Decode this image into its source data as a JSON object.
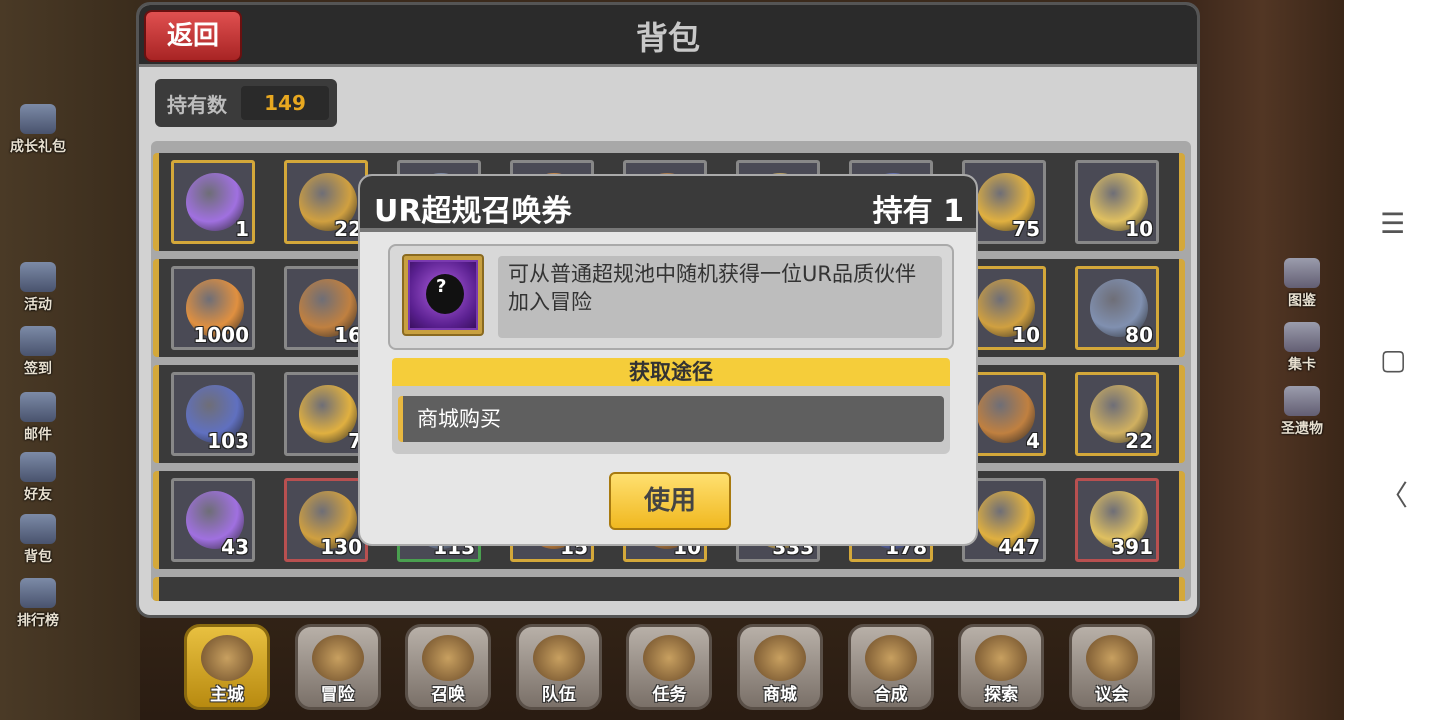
{
  "panel": {
    "title": "背包",
    "back_label": "返回",
    "count_label": "持有数",
    "count_value": "149"
  },
  "left_menu": [
    {
      "label": "成长礼包",
      "icon": "gift-bag-icon"
    },
    {
      "label": "活动",
      "icon": "activity-icon"
    },
    {
      "label": "签到",
      "icon": "checkin-icon"
    },
    {
      "label": "邮件",
      "icon": "mail-icon"
    },
    {
      "label": "好友",
      "icon": "friends-icon"
    },
    {
      "label": "背包",
      "icon": "backpack-icon"
    },
    {
      "label": "排行榜",
      "icon": "ranking-icon"
    }
  ],
  "right_menu": [
    {
      "label": "图鉴",
      "icon": "codex-icon"
    },
    {
      "label": "集卡",
      "icon": "card-collect-icon"
    },
    {
      "label": "圣遗物",
      "icon": "relic-icon"
    }
  ],
  "grid": {
    "rows": [
      {
        "items": [
          {
            "qty": "1",
            "border": "gold"
          },
          {
            "qty": "22",
            "border": "gold"
          },
          {
            "qty": "",
            "border": "plain"
          },
          {
            "qty": "",
            "border": "plain"
          },
          {
            "qty": "",
            "border": "plain"
          },
          {
            "qty": "",
            "border": "plain"
          },
          {
            "qty": "",
            "border": "plain"
          },
          {
            "qty": "75",
            "border": "plain"
          },
          {
            "qty": "10",
            "border": "plain"
          }
        ]
      },
      {
        "items": [
          {
            "qty": "1000",
            "border": "plain"
          },
          {
            "qty": "16",
            "border": "plain"
          },
          {
            "qty": "",
            "border": "plain"
          },
          {
            "qty": "",
            "border": "plain"
          },
          {
            "qty": "",
            "border": "plain"
          },
          {
            "qty": "",
            "border": "plain"
          },
          {
            "qty": "",
            "border": "plain"
          },
          {
            "qty": "10",
            "border": "gold"
          },
          {
            "qty": "80",
            "border": "gold"
          }
        ]
      },
      {
        "items": [
          {
            "qty": "103",
            "border": "plain"
          },
          {
            "qty": "7",
            "border": "plain"
          },
          {
            "qty": "",
            "border": "plain"
          },
          {
            "qty": "",
            "border": "plain"
          },
          {
            "qty": "",
            "border": "plain"
          },
          {
            "qty": "",
            "border": "plain"
          },
          {
            "qty": "",
            "border": "plain"
          },
          {
            "qty": "4",
            "border": "gold"
          },
          {
            "qty": "22",
            "border": "gold"
          }
        ]
      },
      {
        "items": [
          {
            "qty": "43",
            "border": "plain"
          },
          {
            "qty": "130",
            "border": "red"
          },
          {
            "qty": "113",
            "border": "green"
          },
          {
            "qty": "15",
            "border": "gold"
          },
          {
            "qty": "10",
            "border": "gold"
          },
          {
            "qty": "333",
            "border": "plain"
          },
          {
            "qty": "178",
            "border": "gold"
          },
          {
            "qty": "447",
            "border": "plain"
          },
          {
            "qty": "391",
            "border": "red"
          }
        ]
      }
    ]
  },
  "bottom_nav": [
    {
      "label": "主城",
      "icon": "castle-icon",
      "active": true
    },
    {
      "label": "冒险",
      "icon": "adventure-icon",
      "active": false
    },
    {
      "label": "召唤",
      "icon": "summon-icon",
      "active": false
    },
    {
      "label": "队伍",
      "icon": "team-icon",
      "active": false
    },
    {
      "label": "任务",
      "icon": "quest-icon",
      "active": false
    },
    {
      "label": "商城",
      "icon": "shop-icon",
      "active": false
    },
    {
      "label": "合成",
      "icon": "craft-icon",
      "active": false
    },
    {
      "label": "探索",
      "icon": "explore-icon",
      "active": false
    },
    {
      "label": "议会",
      "icon": "council-icon",
      "active": false
    }
  ],
  "dialog": {
    "title": "UR超规召唤券",
    "owned": "持有 1",
    "description": "可从普通超规池中随机获得一位UR品质伙伴加入冒险",
    "source_header": "获取途径",
    "source_item": "商城购买",
    "use_label": "使用"
  },
  "system_nav": {
    "menu_glyph": "☰",
    "home_glyph": "▢",
    "back_glyph": "〈"
  }
}
